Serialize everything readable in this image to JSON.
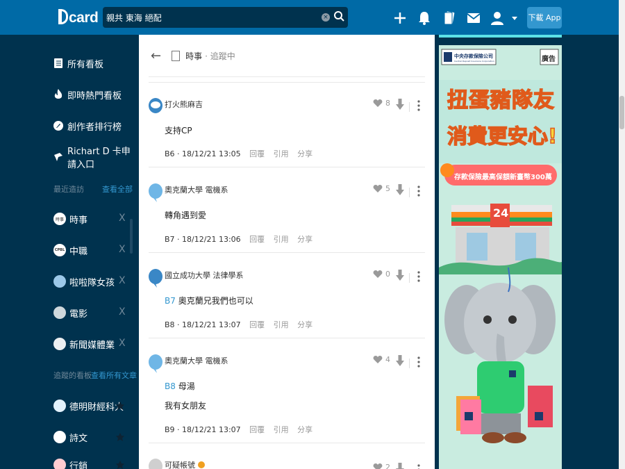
{
  "app": {
    "logo": "card"
  },
  "search": {
    "value": "親共 東海 絕配"
  },
  "header": {
    "download_label": "下載 App"
  },
  "sidebar": {
    "nav": [
      {
        "label": "所有看板",
        "icon": "list-icon"
      },
      {
        "label": "即時熱門看板",
        "icon": "fire-icon"
      },
      {
        "label": "創作者排行榜",
        "icon": "rocket-icon"
      },
      {
        "label": "Richart D 卡申請入口",
        "icon": "dcard-promo-icon"
      }
    ],
    "recent_title": "最近造訪",
    "recent_link": "查看全部",
    "recent": [
      {
        "label": "時事",
        "badge": "時事"
      },
      {
        "label": "中職",
        "badge": "CPBL"
      },
      {
        "label": "啦啦隊女孩",
        "badge": ""
      },
      {
        "label": "電影",
        "badge": ""
      },
      {
        "label": "新聞媒體業",
        "badge": ""
      }
    ],
    "close_glyph": "X",
    "followed_title": "追蹤的看板",
    "followed_link": "查看所有文章",
    "followed": [
      {
        "label": "德明財經科大"
      },
      {
        "label": "詩文"
      },
      {
        "label": "行銷"
      }
    ]
  },
  "post": {
    "board": "時事",
    "status": "· 追蹤中"
  },
  "comments": [
    {
      "author": "打火熊麻吉",
      "lines": [
        {
          "ref": "",
          "text": "支持CP"
        }
      ],
      "floor": "B6",
      "time": "18/12/21 13:05",
      "likes": "8"
    },
    {
      "author": "奧克蘭大學 電機系",
      "lines": [
        {
          "ref": "",
          "text": "轉角遇到愛"
        }
      ],
      "floor": "B7",
      "time": "18/12/21 13:06",
      "likes": "5"
    },
    {
      "author": "國立成功大學 法律學系",
      "lines": [
        {
          "ref": "B7",
          "text": " 奧克蘭兄我們也可以"
        }
      ],
      "floor": "B8",
      "time": "18/12/21 13:07",
      "likes": "0"
    },
    {
      "author": "奧克蘭大學 電機系",
      "lines": [
        {
          "ref": "B8",
          "text": " 母湯"
        },
        {
          "ref": "",
          "text": "我有女朋友"
        }
      ],
      "floor": "B9",
      "time": "18/12/21 13:07",
      "likes": "4"
    },
    {
      "author": "可疑帳號",
      "lines": [],
      "floor": "",
      "time": "",
      "likes": "2"
    }
  ],
  "comment_actions": {
    "reply": "回覆",
    "quote": "引用",
    "share": "分享"
  },
  "ad": {
    "badge": "廣告",
    "sponsor": "中央存款保險公司",
    "sponsor_en": "Central Deposit Insurance Corporation",
    "headline_1": "扭蛋豬隊友",
    "headline_2": "消費更安心!",
    "banner": "存款保險最高保額新臺幣300萬",
    "store_sign": "24",
    "colors": {
      "headline": "#f7d53a",
      "banner": "#ff6b6b",
      "accent": "#ff8a1e"
    }
  },
  "colors": {
    "topbar": "#006aa6",
    "sidebar": "#00324e",
    "accent": "#3397cf"
  }
}
